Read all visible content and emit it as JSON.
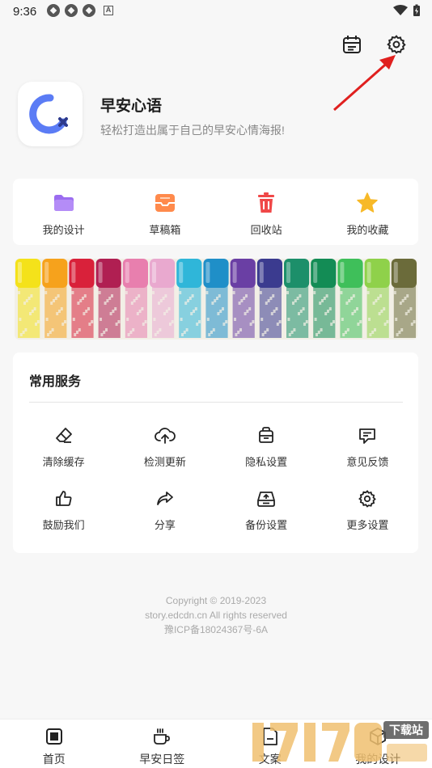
{
  "status_bar": {
    "time": "9:36"
  },
  "app": {
    "title": "早安心语",
    "subtitle": "轻松打造出属于自己的早安心情海报!"
  },
  "top_icons": {
    "calendar": "calendar-icon",
    "settings": "gear-icon"
  },
  "quick_actions": [
    {
      "label": "我的设计",
      "icon": "folder-icon",
      "color": "#9b6cf0"
    },
    {
      "label": "草稿箱",
      "icon": "inbox-icon",
      "color": "#ff8a4c"
    },
    {
      "label": "回收站",
      "icon": "trash-icon",
      "color": "#f04848"
    },
    {
      "label": "我的收藏",
      "icon": "star-icon",
      "color": "#f7b928"
    }
  ],
  "services": {
    "title": "常用服务",
    "items": [
      {
        "label": "清除缓存",
        "icon": "eraser-icon"
      },
      {
        "label": "检测更新",
        "icon": "cloud-upload-icon"
      },
      {
        "label": "隐私设置",
        "icon": "privacy-icon"
      },
      {
        "label": "意见反馈",
        "icon": "feedback-icon"
      },
      {
        "label": "鼓励我们",
        "icon": "thumbs-up-icon"
      },
      {
        "label": "分享",
        "icon": "share-icon"
      },
      {
        "label": "备份设置",
        "icon": "backup-icon"
      },
      {
        "label": "更多设置",
        "icon": "gear-icon"
      }
    ]
  },
  "copyright": {
    "line1": "Copyright © 2019-2023",
    "line2": "story.edcdn.cn All rights reserved",
    "line3": "豫ICP备18024367号-6A"
  },
  "bottom_nav": [
    {
      "label": "首页",
      "icon": "home-icon"
    },
    {
      "label": "早安日签",
      "icon": "coffee-icon"
    },
    {
      "label": "文案",
      "icon": "document-icon"
    },
    {
      "label": "我的设计",
      "icon": "box-icon"
    }
  ],
  "watermark": {
    "text": "下载站"
  },
  "colors": {
    "accent_blue": "#5b7cf5",
    "background": "#f7f7f7",
    "annotation_red": "#e0201f"
  }
}
